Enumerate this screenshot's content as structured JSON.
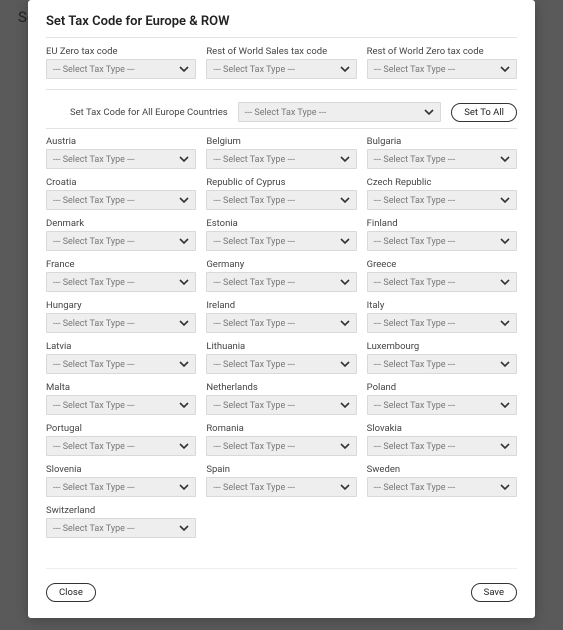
{
  "background": {
    "partial_text": "Sett"
  },
  "modal": {
    "title": "Set Tax Code for Europe & ROW",
    "top_selects": [
      {
        "label": "EU Zero tax code",
        "placeholder": "--- Select Tax Type ---"
      },
      {
        "label": "Rest of World Sales tax code",
        "placeholder": "--- Select Tax Type ---"
      },
      {
        "label": "Rest of World Zero tax code",
        "placeholder": "--- Select Tax Type ---"
      }
    ],
    "set_all": {
      "label": "Set Tax Code for All Europe Countries",
      "placeholder": "--- Select Tax Type ---",
      "button": "Set To All"
    },
    "country_placeholder": "--- Select Tax Type ---",
    "countries": [
      [
        "Austria",
        "Belgium",
        "Bulgaria"
      ],
      [
        "Croatia",
        "Republic of Cyprus",
        "Czech Republic"
      ],
      [
        "Denmark",
        "Estonia",
        "Finland"
      ],
      [
        "France",
        "Germany",
        "Greece"
      ],
      [
        "Hungary",
        "Ireland",
        "Italy"
      ],
      [
        "Latvia",
        "Lithuania",
        "Luxembourg"
      ],
      [
        "Malta",
        "Netherlands",
        "Poland"
      ],
      [
        "Portugal",
        "Romania",
        "Slovakia"
      ],
      [
        "Slovenia",
        "Spain",
        "Sweden"
      ],
      [
        "Switzerland",
        "",
        ""
      ]
    ],
    "footer": {
      "close": "Close",
      "save": "Save"
    }
  }
}
